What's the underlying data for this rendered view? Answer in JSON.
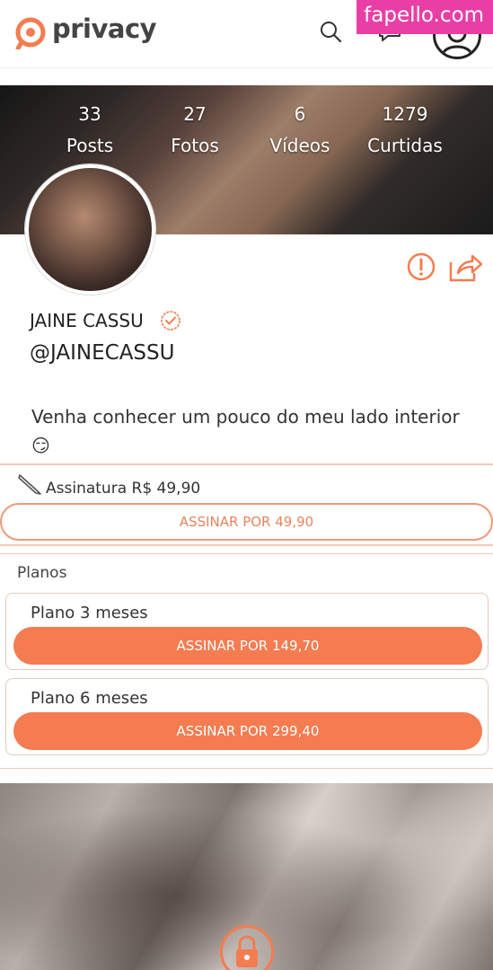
{
  "header": {
    "brand": "privacy",
    "watermark": "fapello.com",
    "brand_color": "#f47c50"
  },
  "stats": [
    {
      "number": "33",
      "label": "Posts"
    },
    {
      "number": "27",
      "label": "Fotos"
    },
    {
      "number": "6",
      "label": "Vídeos"
    },
    {
      "number": "1279",
      "label": "Curtidas"
    }
  ],
  "profile": {
    "name": "JAINE CASSU",
    "handle": "@JAINECASSU",
    "bio": "Venha conhecer um pouco do meu lado interior 😏",
    "verified": true
  },
  "subscription": {
    "label": "Assinatura R$ 49,90",
    "button": "ASSINAR POR 49,90"
  },
  "plans": {
    "title": "Planos",
    "items": [
      {
        "name": "Plano 3 meses",
        "button": "ASSINAR POR 149,70"
      },
      {
        "name": "Plano 6 meses",
        "button": "ASSINAR POR 299,40"
      }
    ]
  },
  "icons": {
    "search": "search-icon",
    "chat": "chat-icon",
    "avatar": "user-avatar-icon",
    "report": "alert-icon",
    "share": "share-icon",
    "verified": "verified-badge-icon",
    "pencil": "pencil-icon",
    "lock": "lock-icon"
  }
}
